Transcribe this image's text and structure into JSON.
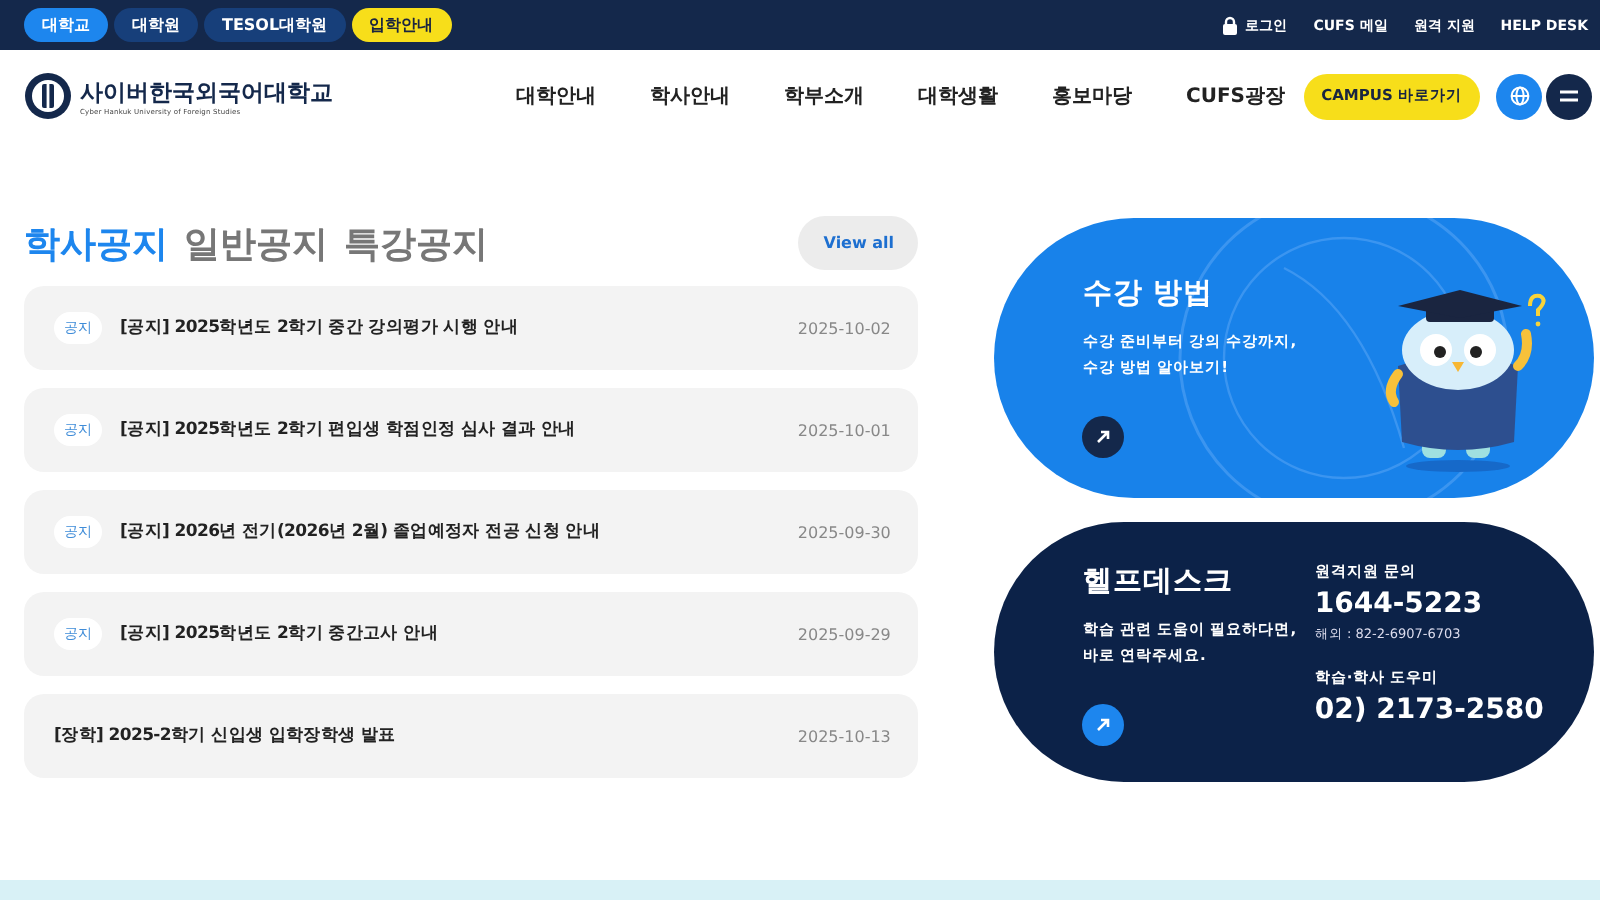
{
  "top_tabs": [
    {
      "label": "대학교",
      "selected": true,
      "kind": "plain"
    },
    {
      "label": "대학원",
      "selected": false,
      "kind": "plain"
    },
    {
      "label": "TESOL대학원",
      "selected": false,
      "kind": "plain"
    },
    {
      "label": "입학안내",
      "selected": false,
      "kind": "highlight"
    }
  ],
  "utility_links": [
    {
      "label": "로그인",
      "kind": "lock"
    },
    {
      "label": "CUFS 메일",
      "kind": "plain"
    },
    {
      "label": "원격 지원",
      "kind": "plain"
    },
    {
      "label": "HELP DESK",
      "kind": "plain"
    }
  ],
  "logo": {
    "name": "사이버한국외국어대학교",
    "subtitle": "Cyber Hankuk University of Foreign Studies"
  },
  "nav": [
    "대학안내",
    "학사안내",
    "학부소개",
    "대학생활",
    "홍보마당",
    "CUFS광장"
  ],
  "campus_button": "CAMPUS 바로가기",
  "notice_tabs": [
    {
      "label": "학사공지",
      "selected": true
    },
    {
      "label": "일반공지",
      "selected": false
    },
    {
      "label": "특강공지",
      "selected": false
    }
  ],
  "view_all": "View all",
  "notices": [
    {
      "tag": "공지",
      "title": "[공지] 2025학년도 2학기 중간 강의평가 시행 안내",
      "date": "2025-10-02"
    },
    {
      "tag": "공지",
      "title": "[공지] 2025학년도 2학기 편입생 학점인정 심사 결과 안내",
      "date": "2025-10-01"
    },
    {
      "tag": "공지",
      "title": "[공지] 2026년 전기(2026년 2월) 졸업예정자 전공 신청 안내",
      "date": "2025-09-30"
    },
    {
      "tag": "공지",
      "title": "[공지] 2025학년도 2학기 중간고사 안내",
      "date": "2025-09-29"
    },
    {
      "title": "[장학] 2025-2학기 신입생 입학장학생 발표",
      "date": "2025-10-13"
    }
  ],
  "course_card": {
    "title": "수강 방법",
    "lines": [
      "수강 준비부터 강의 수강까지,",
      "수강 방법 알아보기!"
    ]
  },
  "helpdesk": {
    "title": "헬프데스크",
    "lines": [
      "학습 관련 도움이 필요하다면,",
      "바로 연락주세요."
    ],
    "contacts": [
      {
        "label": "원격지원 문의",
        "number": "1644-5223",
        "note": "해외 : 82-2-6907-6703"
      },
      {
        "label": "학습·학사 도우미",
        "number": "02) 2173-2580"
      }
    ]
  }
}
